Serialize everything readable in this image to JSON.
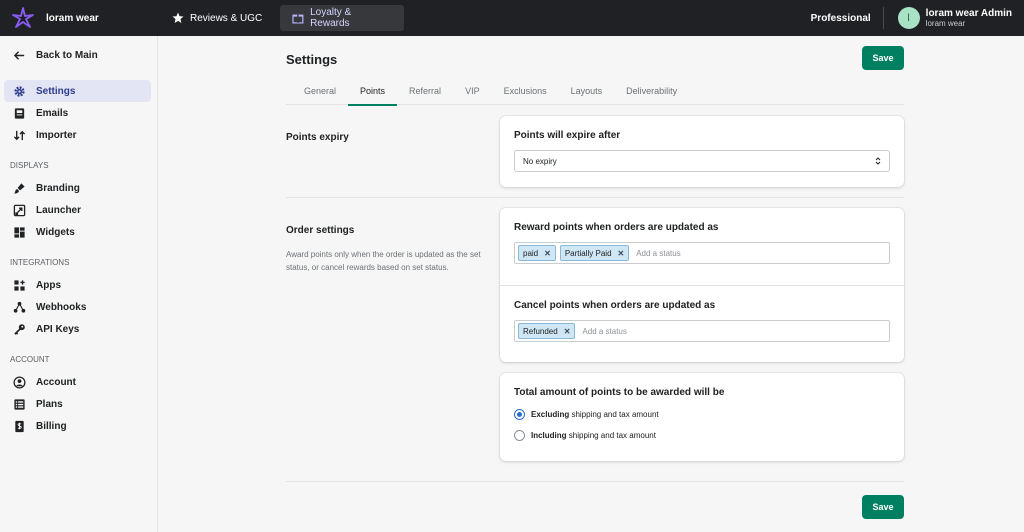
{
  "topbar": {
    "brand_name": "loram wear",
    "tabs": [
      {
        "label": "Reviews & UGC",
        "icon": "star-icon"
      },
      {
        "label": "Loyalty & Rewards",
        "icon": "gift-icon"
      }
    ],
    "plan": "Professional",
    "user": {
      "initial": "l",
      "name": "loram wear Admin",
      "store": "loram wear"
    }
  },
  "sidebar": {
    "back_label": "Back to Main",
    "main_items": [
      {
        "label": "Settings",
        "icon": "gear-icon"
      },
      {
        "label": "Emails",
        "icon": "email-icon"
      },
      {
        "label": "Importer",
        "icon": "import-icon"
      }
    ],
    "sections": [
      {
        "title": "DISPLAYS",
        "items": [
          {
            "label": "Branding",
            "icon": "paintbrush-icon"
          },
          {
            "label": "Launcher",
            "icon": "launcher-icon"
          },
          {
            "label": "Widgets",
            "icon": "widgets-icon"
          }
        ]
      },
      {
        "title": "INTEGRATIONS",
        "items": [
          {
            "label": "Apps",
            "icon": "apps-icon"
          },
          {
            "label": "Webhooks",
            "icon": "webhooks-icon"
          },
          {
            "label": "API Keys",
            "icon": "key-icon"
          }
        ]
      },
      {
        "title": "ACCOUNT",
        "items": [
          {
            "label": "Account",
            "icon": "account-icon"
          },
          {
            "label": "Plans",
            "icon": "plans-icon"
          },
          {
            "label": "Billing",
            "icon": "billing-icon"
          }
        ]
      }
    ]
  },
  "page": {
    "title": "Settings",
    "save_label": "Save",
    "tabs": [
      "General",
      "Points",
      "Referral",
      "VIP",
      "Exclusions",
      "Layouts",
      "Deliverability"
    ],
    "active_tab": "Points"
  },
  "points_expiry": {
    "section_title": "Points expiry",
    "label": "Points will expire after",
    "selected": "No expiry"
  },
  "order_settings": {
    "section_title": "Order settings",
    "description": "Award points only when the order is updated as the set status, or cancel rewards based on set status.",
    "reward": {
      "label": "Reward points when orders are updated as",
      "tags": [
        "paid",
        "Partially Paid"
      ],
      "placeholder": "Add a status"
    },
    "cancel": {
      "label": "Cancel points when orders are updated as",
      "tags": [
        "Refunded"
      ],
      "placeholder": "Add a status"
    },
    "total": {
      "label": "Total amount of points to be awarded will be",
      "options": [
        {
          "bold": "Excluding",
          "rest": " shipping and tax amount",
          "checked": true
        },
        {
          "bold": "Including",
          "rest": " shipping and tax amount",
          "checked": false
        }
      ]
    }
  },
  "colors": {
    "primary": "#008060",
    "topbar": "#1f2124",
    "active_nav": "#e3e5f4",
    "tag_bg": "#cfe6f5",
    "radio": "#2c6ecb"
  }
}
